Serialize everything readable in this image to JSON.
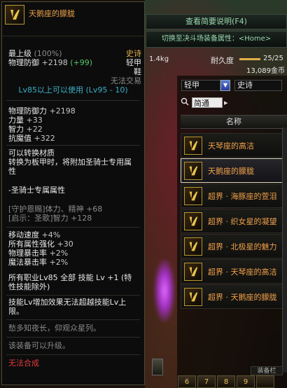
{
  "tooltip": {
    "item_name": "天鹅座的朦胧",
    "icon": "armor-glyph-icon",
    "max_level": "最上级",
    "max_level_pct": "(100%)",
    "rarity": "史诗",
    "def_label": "物理防御",
    "def_value": "+2198",
    "def_bonus": "(+99)",
    "armor_type": "轻甲",
    "slot": "鞋",
    "untradeable": "无法交易",
    "level_req": "Lv85以上可以使用 (Lv95 - 10)",
    "stats": [
      {
        "label": "物理防御力",
        "value": "+2198"
      },
      {
        "label": "力量",
        "value": "+33"
      },
      {
        "label": "智力",
        "value": "+22"
      },
      {
        "label": "抗魔值",
        "value": "+322"
      }
    ],
    "convert_lines": [
      "可以转换材质",
      "转换为板甲时，将附加圣骑士专用属",
      "性"
    ],
    "class_attr": "-圣骑士专属属性",
    "guard_lines": [
      "[守护恩赐]体力、精神 +68",
      "[启示：圣歌]智力 +128"
    ],
    "bonus_stats": [
      {
        "label": "移动速度",
        "value": "+4%"
      },
      {
        "label": "所有属性强化",
        "value": "+30"
      },
      {
        "label": "物理暴击率",
        "value": "+2%"
      },
      {
        "label": "魔法暴击率",
        "value": "+2%"
      }
    ],
    "skill_lines": [
      "所有职业Lv85 全部 技能 Lv +1 (特",
      "性技能除外)"
    ],
    "skill_note_lines": [
      "技能Lv增加效果无法超越技能Lv上",
      "限。"
    ],
    "flavor": "愁多知夜长，仰观众星列。",
    "upgrade_note": "该装备可以升级。",
    "durability_note": "无法合成"
  },
  "shop": {
    "manual_button": "查看简要说明(F4)",
    "switch_button": "切换至决斗场装备属性：<Home>",
    "weight": "1.4kg",
    "durability_label": "耐久度",
    "durability_value": "25/25",
    "durability_fraction": 1.0,
    "gold": "13,089金币",
    "filter_type": "轻甲",
    "filter_rarity": "史诗",
    "search_value": "简通",
    "column_header": "名称",
    "items": [
      {
        "name": "天琴座的高洁",
        "active": false
      },
      {
        "name": "天鹅座的朦胧",
        "active": true
      },
      {
        "name": "超界 · 海豚座的萱泪",
        "active": false
      },
      {
        "name": "超界 · 织女星的凝望",
        "active": false
      },
      {
        "name": "超界 · 北极星的魅力",
        "active": false
      },
      {
        "name": "超界 · 天琴座的高洁",
        "active": false
      },
      {
        "name": "超界 · 天鹅座的朦胧",
        "active": false
      }
    ],
    "bottom_tab": "装备栏",
    "dock": [
      "6",
      "7",
      "8",
      "9",
      ""
    ]
  },
  "colors": {
    "item_name": "#e7a14a",
    "rarity": "#e0b04a",
    "level_req": "#3ab0c8",
    "guard": "#8a8a8a",
    "warn": "#e03a3a"
  }
}
